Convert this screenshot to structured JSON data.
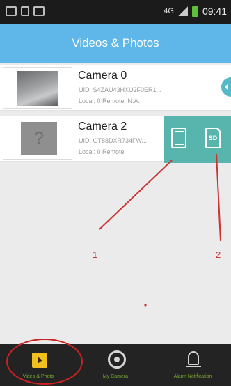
{
  "status_bar": {
    "time": "09:41",
    "network_label": "4G"
  },
  "header": {
    "title": "Videos & Photos"
  },
  "cameras": [
    {
      "name": "Camera 0",
      "uid": "UID: S4ZAU43HXU2F0ER1...",
      "local_remote": "Local: 0    Remote: N.A."
    },
    {
      "name": "Camera 2",
      "uid": "UID: GT88DXR734FW...",
      "local_remote": "Local: 0    Remote"
    }
  ],
  "actions": {
    "device_icon": "tablet-icon",
    "sd_icon": "sd-card-icon",
    "sd_label": "SD"
  },
  "annotations": {
    "label_1": "1",
    "label_2": "2",
    "color": "#cc3333"
  },
  "tabbar": {
    "tabs": [
      {
        "label": "Video & Photo",
        "icon": "video-folder-icon"
      },
      {
        "label": "My Camera",
        "icon": "camera-icon"
      },
      {
        "label": "Alarm Notification",
        "icon": "bell-icon"
      }
    ]
  },
  "colors": {
    "header": "#5fb6e8",
    "action_panel": "#57b5ad",
    "tab_active_icon": "#f2c01e"
  }
}
